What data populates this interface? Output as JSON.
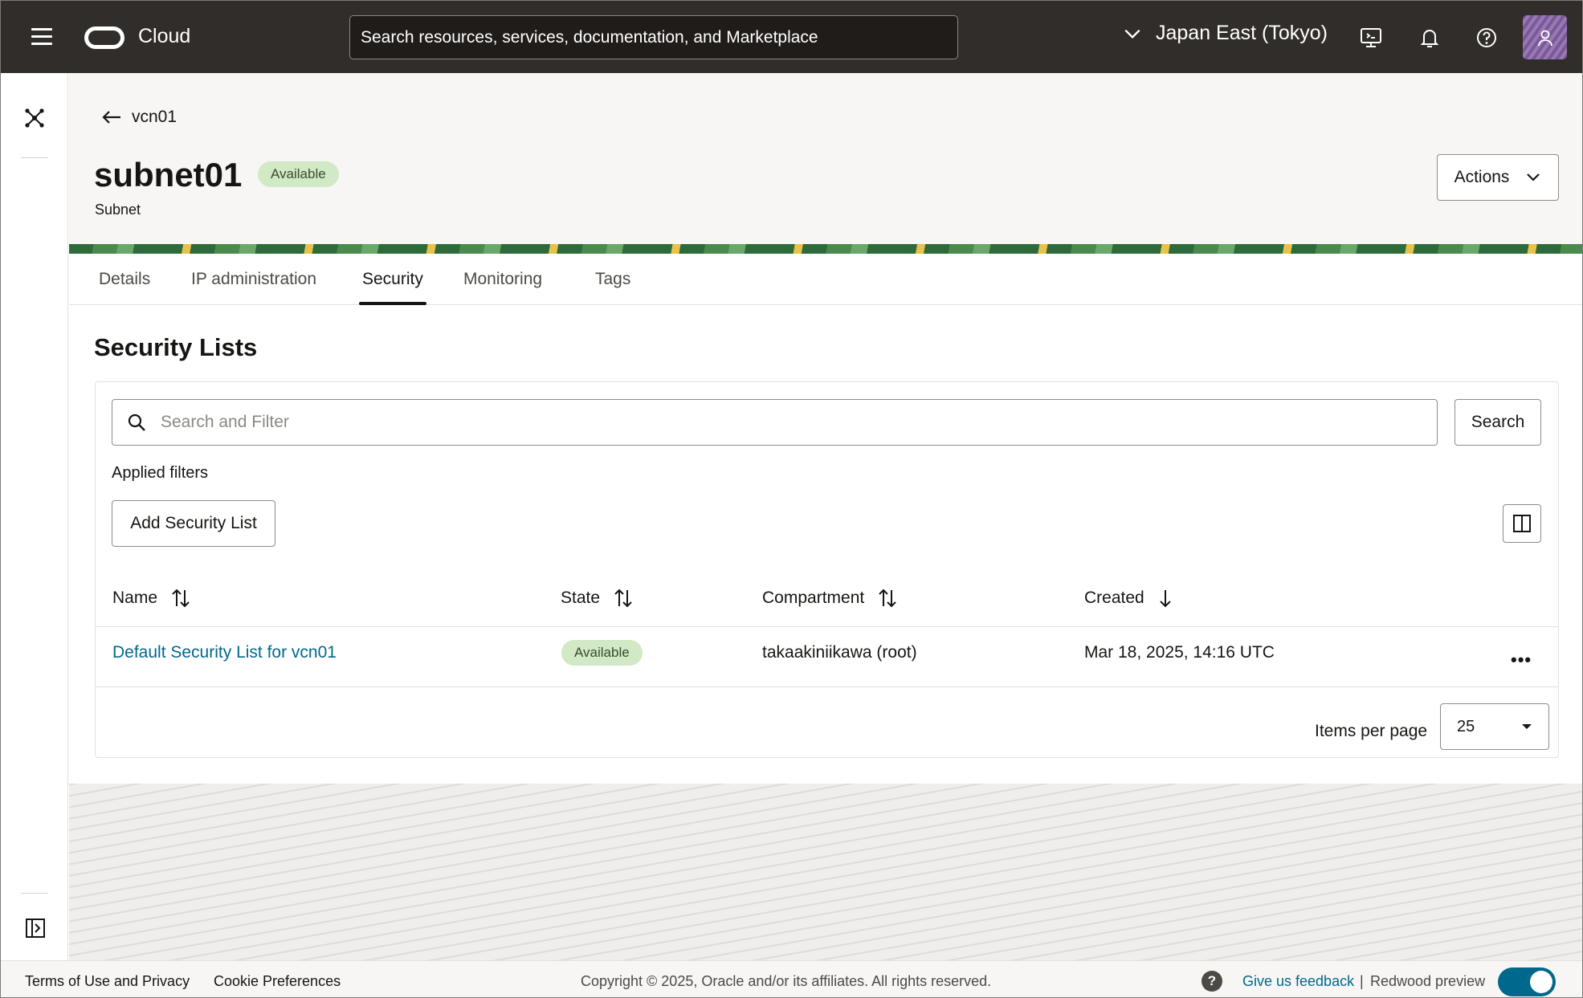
{
  "topbar": {
    "brand": "Cloud",
    "search_placeholder": "Search resources, services, documentation, and Marketplace",
    "region": "Japan East (Tokyo)"
  },
  "header": {
    "back_label": "vcn01",
    "title": "subnet01",
    "status": "Available",
    "subtitle": "Subnet",
    "actions_label": "Actions"
  },
  "tabs": [
    {
      "label": "Details"
    },
    {
      "label": "IP administration"
    },
    {
      "label": "Security"
    },
    {
      "label": "Monitoring"
    },
    {
      "label": "Tags"
    }
  ],
  "active_tab": "Security",
  "security_lists": {
    "title": "Security Lists",
    "filter_placeholder": "Search and Filter",
    "search_label": "Search",
    "applied_filters_label": "Applied filters",
    "add_label": "Add Security List",
    "columns": [
      "Name",
      "State",
      "Compartment",
      "Created"
    ],
    "rows": [
      {
        "name": "Default Security List for vcn01",
        "state": "Available",
        "compartment": "takaakiniikawa (root)",
        "created": "Mar 18, 2025, 14:16 UTC"
      }
    ],
    "items_per_page_label": "Items per page",
    "items_per_page": "25"
  },
  "footer": {
    "terms": "Terms of Use and Privacy",
    "cookies": "Cookie Preferences",
    "copyright": "Copyright © 2025, Oracle and/or its affiliates. All rights reserved.",
    "feedback": "Give us feedback",
    "separator": "|",
    "redwood": "Redwood preview"
  },
  "colors": {
    "topbar": "#312d2a",
    "link": "#00688c",
    "badge_bg": "#d1e9c4"
  }
}
